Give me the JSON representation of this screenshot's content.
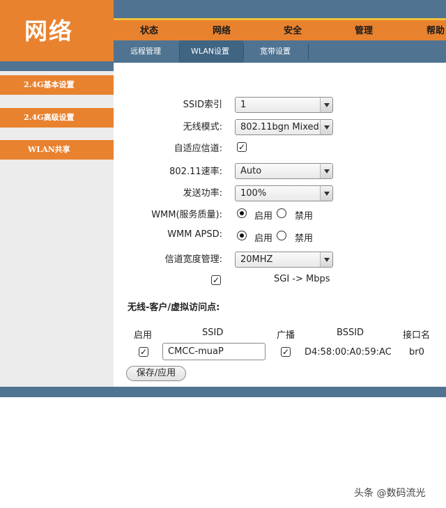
{
  "brand": {
    "title": "网络"
  },
  "main_nav": [
    "状态",
    "网络",
    "安全",
    "管理",
    "帮助"
  ],
  "sub_nav": [
    "远程管理",
    "WLAN设置",
    "宽带设置"
  ],
  "sidebar": {
    "items": [
      "2.4G基本设置",
      "2.4G高级设置",
      "WLAN共享"
    ]
  },
  "form": {
    "ssid_index": {
      "label": "SSID索引",
      "value": "1"
    },
    "wireless_mode": {
      "label": "无线模式:",
      "value": "802.11bgn Mixed"
    },
    "adaptive_channel": {
      "label": "自适应信道:",
      "checked": true
    },
    "rate": {
      "label": "802.11速率:",
      "value": "Auto"
    },
    "tx_power": {
      "label": "发送功率:",
      "value": "100%"
    },
    "wmm": {
      "label": "WMM(服务质量):",
      "on_label": "启用",
      "off_label": "禁用",
      "selected": "启用"
    },
    "wmm_apsd": {
      "label": "WMM APSD:",
      "on_label": "启用",
      "off_label": "禁用",
      "selected": "启用"
    },
    "bandwidth": {
      "label": "信道宽度管理:",
      "value": "20MHZ"
    },
    "sgi": {
      "checked": true,
      "label": "SGI -> Mbps"
    }
  },
  "ap_section": {
    "title": "无线-客户/虚拟访问点:",
    "columns": [
      "启用",
      "SSID",
      "广播",
      "BSSID",
      "接口名"
    ],
    "rows": [
      {
        "enabled": true,
        "ssid": "CMCC-muaP",
        "broadcast": true,
        "bssid": "D4:58:00:A0:59:AC",
        "iface": "br0"
      }
    ]
  },
  "save_button": "保存/应用",
  "watermark": "头条 @数码流光",
  "colors": {
    "orange": "#e8822f",
    "steel_blue": "#4f7391",
    "yellow": "#f2c23c"
  }
}
